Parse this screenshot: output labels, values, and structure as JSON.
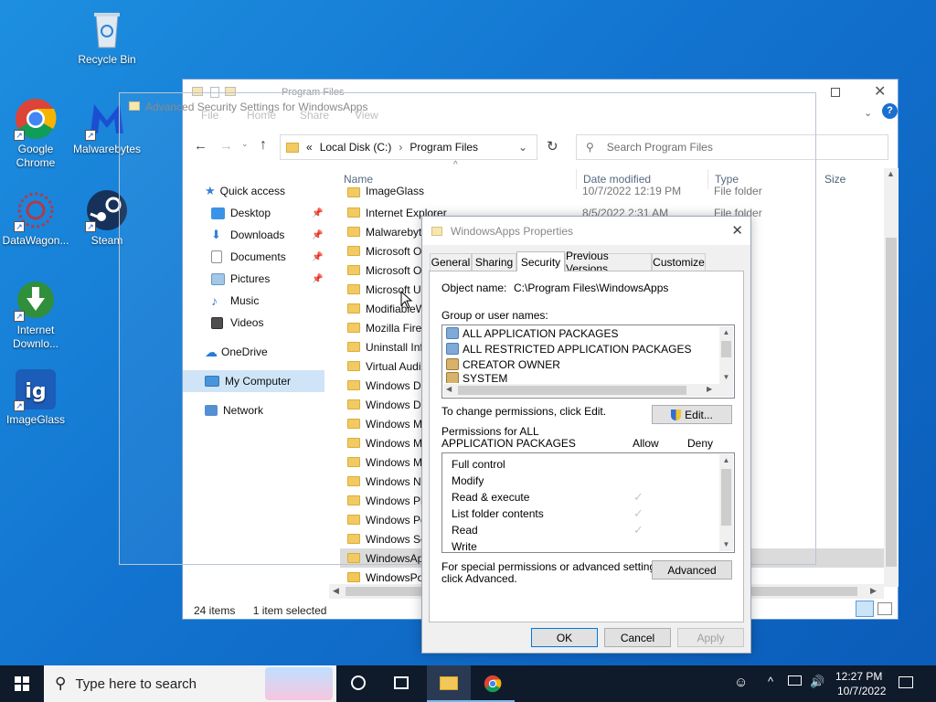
{
  "desktop": {
    "icons": [
      {
        "label": "Recycle Bin"
      },
      {
        "label": "Google Chrome"
      },
      {
        "label": "Malwarebytes"
      },
      {
        "label": "DataWagon..."
      },
      {
        "label": "Steam"
      },
      {
        "label": "Internet Downlo..."
      },
      {
        "label": "ImageGlass"
      }
    ]
  },
  "ghost_window": {
    "title": "Advanced Security Settings for WindowsApps"
  },
  "explorer": {
    "title": "Program Files",
    "ribbon": [
      "File",
      "Home",
      "Share",
      "View"
    ],
    "address": {
      "root": "Local Disk (C:)",
      "current": "Program Files",
      "separator": "«"
    },
    "search_placeholder": "Search Program Files",
    "nav": [
      {
        "label": "Quick access"
      },
      {
        "label": "Desktop"
      },
      {
        "label": "Downloads"
      },
      {
        "label": "Documents"
      },
      {
        "label": "Pictures"
      },
      {
        "label": "Music"
      },
      {
        "label": "Videos"
      },
      {
        "label": "OneDrive"
      },
      {
        "label": "My Computer"
      },
      {
        "label": "Network"
      }
    ],
    "columns": {
      "name": "Name",
      "date": "Date modified",
      "type": "Type",
      "size": "Size"
    },
    "files": [
      {
        "name": "ImageGlass",
        "date": "10/7/2022 12:19 PM",
        "type": "File folder"
      },
      {
        "name": "Internet Explorer",
        "date": "8/5/2022 2:31 AM",
        "type": "File folder"
      },
      {
        "name": "Malwarebyte",
        "date": "",
        "type": "er"
      },
      {
        "name": "Microsoft Of",
        "date": "",
        "type": "er"
      },
      {
        "name": "Microsoft Of",
        "date": "",
        "type": "er"
      },
      {
        "name": "Microsoft Up",
        "date": "",
        "type": "er"
      },
      {
        "name": "ModifiableW",
        "date": "",
        "type": "er"
      },
      {
        "name": "Mozilla Firef",
        "date": "",
        "type": "er"
      },
      {
        "name": "Uninstall Inf",
        "date": "",
        "type": "er"
      },
      {
        "name": "Virtual Audi",
        "date": "",
        "type": "er"
      },
      {
        "name": "Windows De",
        "date": "",
        "type": "er"
      },
      {
        "name": "Windows De",
        "date": "",
        "type": "er"
      },
      {
        "name": "Windows Ma",
        "date": "",
        "type": "er"
      },
      {
        "name": "Windows Me",
        "date": "",
        "type": "er"
      },
      {
        "name": "Windows Mu",
        "date": "",
        "type": "er"
      },
      {
        "name": "Windows NT",
        "date": "",
        "type": "er"
      },
      {
        "name": "Windows Ph",
        "date": "",
        "type": "er"
      },
      {
        "name": "Windows Po",
        "date": "",
        "type": "er"
      },
      {
        "name": "Windows Se",
        "date": "",
        "type": "er"
      },
      {
        "name": "WindowsAp",
        "date": "",
        "type": "er"
      },
      {
        "name": "WindowsPov",
        "date": "",
        "type": "er"
      }
    ],
    "status_count": "24 items",
    "status_selected": "1 item selected"
  },
  "dialog": {
    "title": "WindowsApps Properties",
    "tabs": [
      "General",
      "Sharing",
      "Security",
      "Previous Versions",
      "Customize"
    ],
    "active_tab": "Security",
    "object_label": "Object name:",
    "object_value": "C:\\Program Files\\WindowsApps",
    "group_label": "Group or user names:",
    "groups": [
      {
        "name": "ALL APPLICATION PACKAGES"
      },
      {
        "name": "ALL RESTRICTED APPLICATION PACKAGES"
      },
      {
        "name": "CREATOR OWNER"
      },
      {
        "name": "SYSTEM"
      }
    ],
    "change_text": "To change permissions, click Edit.",
    "edit_button": "Edit...",
    "perm_header_line1": "Permissions for ALL",
    "perm_header_line2": "APPLICATION PACKAGES",
    "allow_label": "Allow",
    "deny_label": "Deny",
    "permissions": [
      {
        "name": "Full control",
        "allow": false
      },
      {
        "name": "Modify",
        "allow": false
      },
      {
        "name": "Read & execute",
        "allow": true
      },
      {
        "name": "List folder contents",
        "allow": true
      },
      {
        "name": "Read",
        "allow": true
      },
      {
        "name": "Write",
        "allow": false
      }
    ],
    "special_text_1": "For special permissions or advanced settings,",
    "special_text_2": "click Advanced.",
    "advanced_button": "Advanced",
    "ok_button": "OK",
    "cancel_button": "Cancel",
    "apply_button": "Apply"
  },
  "taskbar": {
    "search_placeholder": "Type here to search",
    "time": "12:27 PM",
    "date": "10/7/2022"
  }
}
